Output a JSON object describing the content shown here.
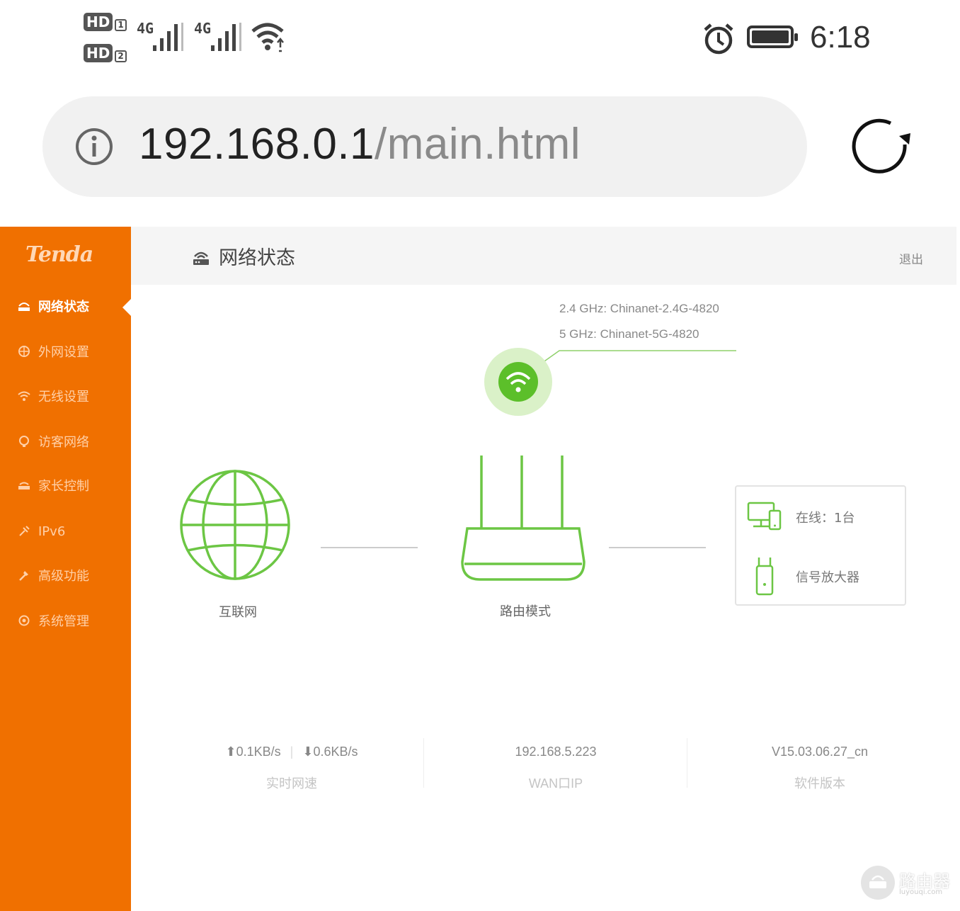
{
  "status_bar": {
    "sim1_label": "HD",
    "sim1_index": "1",
    "sim2_label": "HD",
    "sim2_index": "2",
    "network1": "4G",
    "network2": "4G",
    "time": "6:18",
    "icons": [
      "signal-icon",
      "wifi-icon",
      "alarm-icon",
      "battery-icon"
    ]
  },
  "address_bar": {
    "host": "192.168.0.1",
    "path": "/main.html",
    "icons": [
      "info-icon",
      "reload-icon"
    ]
  },
  "sidebar": {
    "brand": "Tenda",
    "accent_color": "#f07000",
    "items": [
      {
        "label": "网络状态",
        "icon": "router-icon",
        "active": true
      },
      {
        "label": "外网设置",
        "icon": "globe-icon",
        "active": false
      },
      {
        "label": "无线设置",
        "icon": "wifi-icon",
        "active": false
      },
      {
        "label": "访客网络",
        "icon": "guest-icon",
        "active": false
      },
      {
        "label": "家长控制",
        "icon": "parent-icon",
        "active": false
      },
      {
        "label": "IPv6",
        "icon": "ipv6-icon",
        "active": false
      },
      {
        "label": "高级功能",
        "icon": "tool-icon",
        "active": false
      },
      {
        "label": "系统管理",
        "icon": "gear-icon",
        "active": false
      }
    ]
  },
  "header": {
    "title": "网络状态",
    "logout": "退出"
  },
  "wireless": {
    "ssid_24": "2.4 GHz: Chinanet-2.4G-4820",
    "ssid_5": "5 GHz: Chinanet-5G-4820",
    "status_color": "#6cc644"
  },
  "topology": {
    "internet_label": "互联网",
    "router_label": "路由模式",
    "online_label": "在线：1台",
    "extender_label": "信号放大器"
  },
  "stats": {
    "upload": "0.1KB/s",
    "download": "0.6KB/s",
    "speed_label": "实时网速",
    "wan_ip": "192.168.5.223",
    "wan_label": "WAN口IP",
    "version": "V15.03.06.27_cn",
    "version_label": "软件版本"
  },
  "watermark": {
    "text": "路由器",
    "sub": "luyouqi.com"
  }
}
